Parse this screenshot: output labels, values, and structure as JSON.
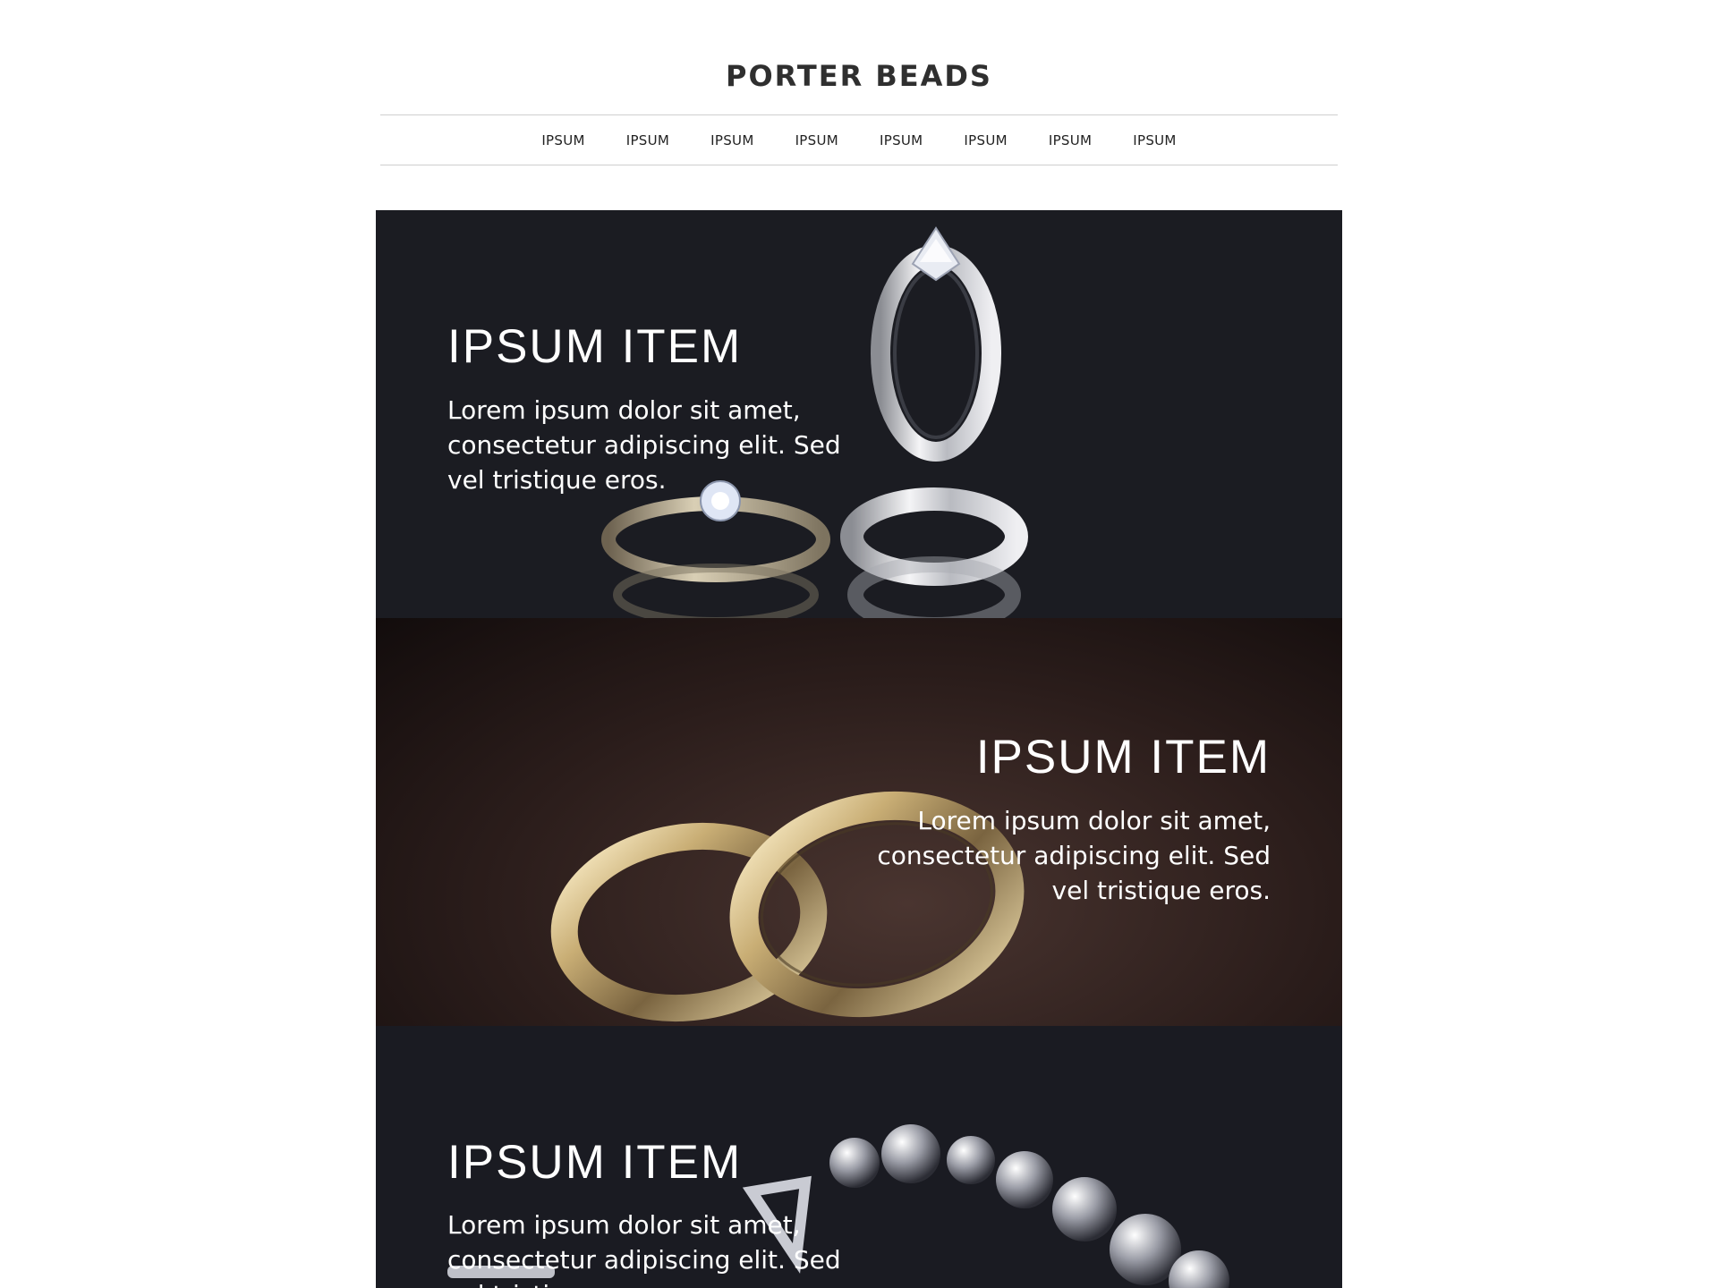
{
  "brand": {
    "name": "PORTER BEADS"
  },
  "nav": {
    "items": [
      "IPSUM",
      "IPSUM",
      "IPSUM",
      "IPSUM",
      "IPSUM",
      "IPSUM",
      "IPSUM",
      "IPSUM"
    ]
  },
  "heroes": [
    {
      "title": "IPSUM ITEM",
      "text": "Lorem ipsum dolor sit amet, consectetur adipiscing elit. Sed vel tristique eros.",
      "image": "diamond-rings-photo"
    },
    {
      "title": "IPSUM ITEM",
      "text": "Lorem ipsum dolor sit amet, consectetur adipiscing elit. Sed vel tristique eros.",
      "image": "gold-wedding-bands-photo"
    },
    {
      "title": "IPSUM ITEM",
      "text": "Lorem ipsum dolor sit amet, consectetur adipiscing elit. Sed vel tristique eros.",
      "image": "crystal-bead-bracelet-photo"
    }
  ],
  "colors": {
    "brand_text": "#2f2f2f",
    "hero_dark": "#1b1c22",
    "hero_brown": "#2b1d1b",
    "text_light": "#ffffff"
  }
}
